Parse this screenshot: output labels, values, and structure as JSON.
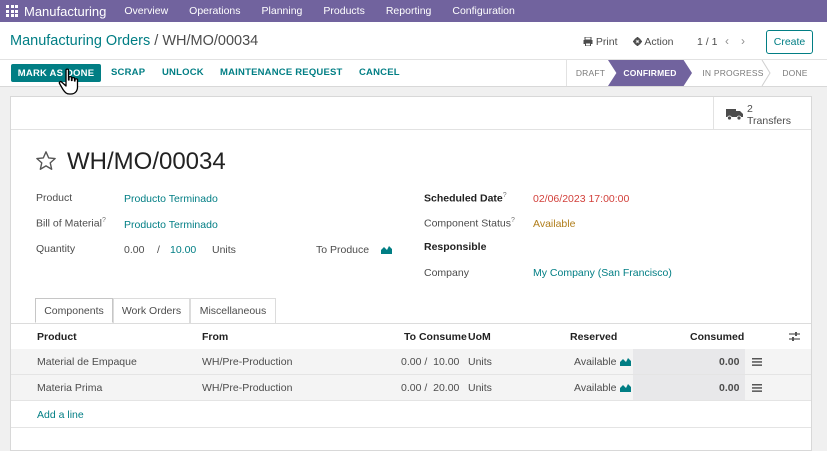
{
  "navbar": {
    "brand": "Manufacturing",
    "items": [
      "Overview",
      "Operations",
      "Planning",
      "Products",
      "Reporting",
      "Configuration"
    ]
  },
  "breadcrumb": {
    "parent": "Manufacturing Orders",
    "separator": " / ",
    "current": "WH/MO/00034"
  },
  "control": {
    "print": "Print",
    "action": "Action",
    "pager": "1 / 1",
    "create": "Create"
  },
  "statusbar": {
    "buttons": {
      "mark_done": "MARK AS DONE",
      "scrap": "SCRAP",
      "unlock": "UNLOCK",
      "maintenance": "MAINTENANCE REQUEST",
      "cancel": "CANCEL"
    },
    "stages": [
      "DRAFT",
      "CONFIRMED",
      "IN PROGRESS",
      "DONE"
    ],
    "active_stage": "CONFIRMED"
  },
  "smart_button": {
    "count": "2",
    "label": "Transfers"
  },
  "record": {
    "title": "WH/MO/00034",
    "left": {
      "product_label": "Product",
      "product_value": "Producto Terminado",
      "bom_label": "Bill of Material",
      "bom_value": "Producto Terminado",
      "qty_label": "Quantity",
      "qty_produced": "0.00",
      "qty_sep": "/",
      "qty_total": "10.00",
      "qty_uom": "Units",
      "to_produce": "To Produce"
    },
    "right": {
      "scheduled_label": "Scheduled Date",
      "scheduled_value": "02/06/2023 17:00:00",
      "component_label": "Component Status",
      "component_value": "Available",
      "responsible_label": "Responsible",
      "company_label": "Company",
      "company_value": "My Company (San Francisco)"
    },
    "help_mark": "?"
  },
  "tabs": [
    "Components",
    "Work Orders",
    "Miscellaneous"
  ],
  "table": {
    "headers": {
      "product": "Product",
      "from": "From",
      "to_consume": "To Consume",
      "uom": "UoM",
      "reserved": "Reserved",
      "consumed": "Consumed"
    },
    "rows": [
      {
        "product": "Material de Empaque",
        "from": "WH/Pre-Production",
        "to_consume": "0.00 /  10.00",
        "uom": "Units",
        "reserved": "Available",
        "consumed": "0.00"
      },
      {
        "product": "Materia Prima",
        "from": "WH/Pre-Production",
        "to_consume": "0.00 /  20.00",
        "uom": "Units",
        "reserved": "Available",
        "consumed": "0.00"
      }
    ],
    "add_line": "Add a line"
  },
  "colors": {
    "navbar": "#71639e",
    "primary": "#017e84",
    "danger": "#d23f3a",
    "success": "#28a745"
  }
}
